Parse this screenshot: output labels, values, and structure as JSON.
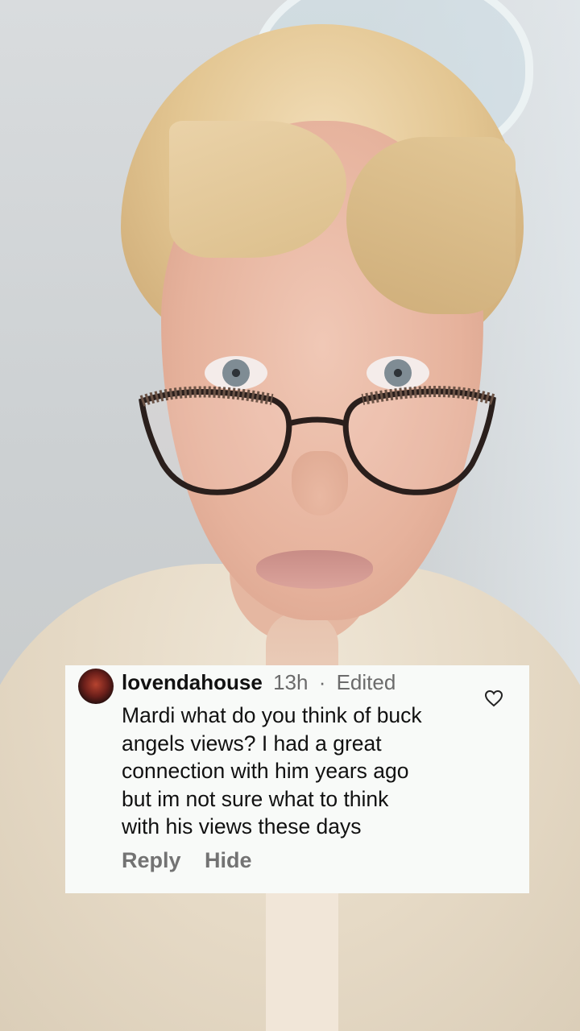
{
  "comment": {
    "username": "lovendahouse",
    "time": "13h",
    "separator": "·",
    "edited": "Edited",
    "text_lines": [
      "Mardi what do you think of buck",
      "angels views? I had a great",
      "connection with him years ago",
      "but im not sure what to think",
      "with his views these days"
    ],
    "actions": {
      "reply": "Reply",
      "hide": "Hide"
    },
    "like_icon": "heart-outline-icon"
  },
  "colors": {
    "card_bg": "#f8faf8",
    "username": "#111111",
    "meta": "#6b6b6b",
    "action": "#737373"
  }
}
